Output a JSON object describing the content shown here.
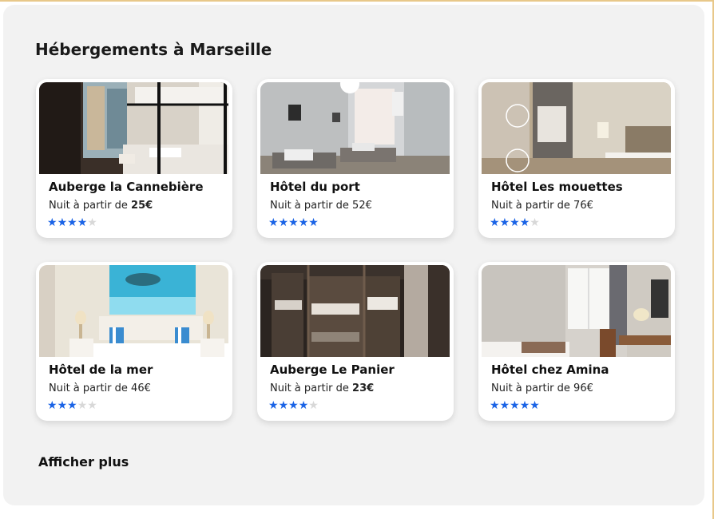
{
  "page": {
    "title": "Hébergements à Marseille",
    "show_more_label": "Afficher plus"
  },
  "colors": {
    "accent_star": "#1a63e6",
    "panel_bg": "#f2f2f2"
  },
  "listings": [
    {
      "name": "Auberge la Cannebière",
      "price_prefix": "Nuit à partir de ",
      "price": "25€",
      "rating": 4,
      "max_rating": 5,
      "image": "bunk-room-photo"
    },
    {
      "name": "Hôtel du port",
      "price_prefix": "Nuit à partir de ",
      "price": "52€",
      "rating": 5,
      "max_rating": 5,
      "image": "twin-bed-room-photo"
    },
    {
      "name": "Hôtel Les mouettes",
      "price_prefix": "Nuit à partir de ",
      "price": "76€",
      "rating": 4,
      "max_rating": 5,
      "image": "modern-room-photo"
    },
    {
      "name": "Hôtel de la mer",
      "price_prefix": "Nuit à partir de ",
      "price": "46€",
      "rating": 3,
      "max_rating": 5,
      "image": "sea-painting-room-photo"
    },
    {
      "name": "Auberge Le Panier",
      "price_prefix": "Nuit à partir de ",
      "price": "23€",
      "rating": 4,
      "max_rating": 5,
      "image": "dorm-bunks-photo"
    },
    {
      "name": "Hôtel chez Amina",
      "price_prefix": "Nuit à partir de ",
      "price": "96€",
      "rating": 5,
      "max_rating": 5,
      "image": "bright-room-photo"
    }
  ]
}
